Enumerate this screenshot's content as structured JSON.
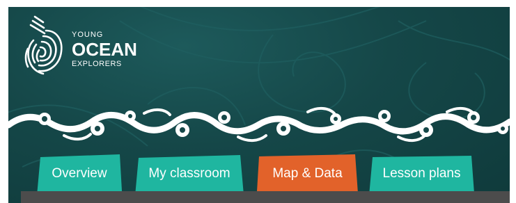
{
  "logo": {
    "line1": "YOUNG",
    "line2": "OCEAN",
    "line3": "EXPLORERS",
    "icon": "fingerprint-wave-icon"
  },
  "tabs": [
    {
      "label": "Overview",
      "color": "#1fb6a0",
      "active": false
    },
    {
      "label": "My classroom",
      "color": "#1fb6a0",
      "active": false
    },
    {
      "label": "Map & Data",
      "color": "#e2622a",
      "active": true
    },
    {
      "label": "Lesson plans",
      "color": "#1fb6a0",
      "active": false
    }
  ],
  "colors": {
    "background": "#154748",
    "teal_tab": "#1fb6a0",
    "orange_tab": "#e2622a",
    "content_strip": "#4c4c4c"
  }
}
